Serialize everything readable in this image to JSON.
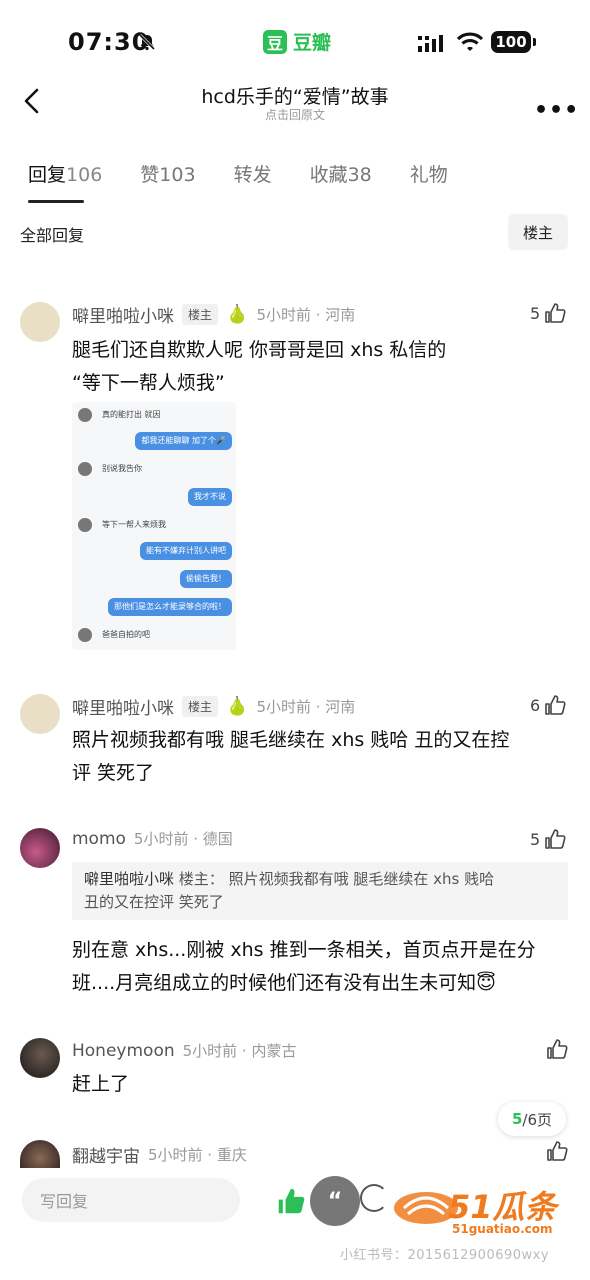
{
  "status_bar": {
    "time": "07:30",
    "app_label": "豆瓣",
    "app_logo_char": "豆",
    "battery": "100"
  },
  "header": {
    "title": "hcd乐手的“爱情”故事",
    "subtitle": "点击回原文"
  },
  "tabs": [
    {
      "label": "回复",
      "count": "106",
      "active": true
    },
    {
      "label": "赞",
      "count": "103",
      "active": false
    },
    {
      "label": "转发",
      "count": "",
      "active": false
    },
    {
      "label": "收藏",
      "count": "38",
      "active": false
    },
    {
      "label": "礼物",
      "count": "",
      "active": false
    }
  ],
  "filter": {
    "all_label": "全部回复",
    "op_label": "楼主"
  },
  "comments": [
    {
      "user": "噼里啪啦小咪",
      "tag": "楼主",
      "time_place": "5小时前 · 河南",
      "likes": "5",
      "text_line1": "腿毛们还自欺欺人呢 你哥哥是回 xhs 私信的",
      "text_line2": "“等下一帮人烦我”"
    },
    {
      "user": "噼里啪啦小咪",
      "tag": "楼主",
      "time_place": "5小时前 · 河南",
      "likes": "6",
      "text_line1": "照片视频我都有哦 腿毛继续在 xhs 贱哈  丑的又在控",
      "text_line2": "评 笑死了"
    },
    {
      "user": "momo",
      "time_place": "5小时前 · 德国",
      "likes": "5",
      "quote_user": "噼里啪啦小咪",
      "quote_tag": "楼主",
      "quote_line1": "照片视频我都有哦 腿毛继续在 xhs 贱哈",
      "quote_line2": "丑的又在控评 笑死了",
      "text_line1": "别在意 xhs...刚被 xhs 推到一条相关，首页点开是在分",
      "text_line2": "班....月亮组成立的时候他们还有没有出生未可知😇"
    },
    {
      "user": "Honeymoon",
      "time_place": "5小时前 · 内蒙古",
      "text_line1": "赶上了"
    },
    {
      "user": "翻越宇宙",
      "time_place": "5小时前 · 重庆"
    }
  ],
  "chat_image": {
    "messages": [
      {
        "side": "l",
        "text": "真的能打出 就因"
      },
      {
        "side": "r",
        "text": "都我还能聊聊 加了个🎤"
      },
      {
        "side": "l",
        "text": "别说我告你"
      },
      {
        "side": "r",
        "text": "我才不说"
      },
      {
        "side": "l",
        "text": "等下一帮人来烦我"
      },
      {
        "side": "r",
        "text": "能有不嫌弃计别人讲吧"
      },
      {
        "side": "r",
        "text": "偷偷告我！"
      },
      {
        "side": "r",
        "text": "那他们是怎么才能录够合的啦！"
      },
      {
        "side": "l",
        "text": "爸爸自拍的吧"
      }
    ]
  },
  "pagination": {
    "current": "5",
    "total": "/6页"
  },
  "bottom_bar": {
    "reply_placeholder": "写回复"
  },
  "watermark": {
    "brand": "51瓜条",
    "site": "51guatiao.com",
    "caption": "小红书号：2015612900690wxy"
  },
  "colors": {
    "accent_green": "#2dbf57",
    "watermark_orange": "#f07a1e"
  }
}
